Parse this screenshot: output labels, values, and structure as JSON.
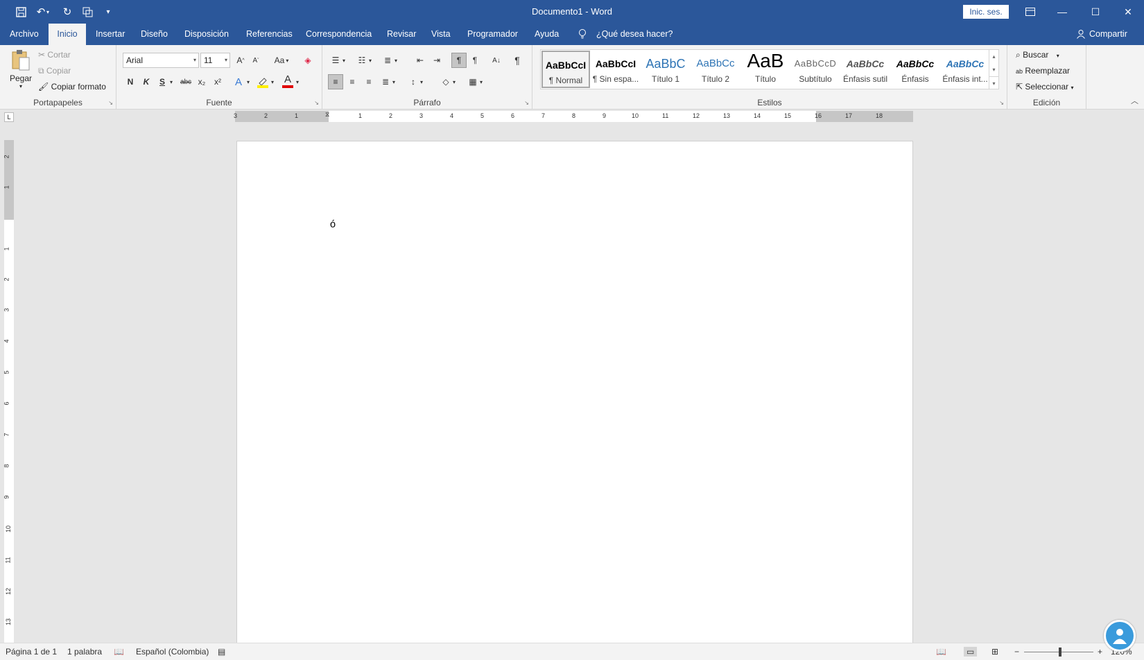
{
  "window": {
    "title": "Documento1 - Word",
    "signin": "Inic. ses.",
    "share": "Compartir"
  },
  "tabs": [
    "Archivo",
    "Inicio",
    "Insertar",
    "Diseño",
    "Disposición",
    "Referencias",
    "Correspondencia",
    "Revisar",
    "Vista",
    "Programador",
    "Ayuda"
  ],
  "tell_me": "¿Qué desea hacer?",
  "clipboard": {
    "label": "Portapapeles",
    "paste": "Pegar",
    "cut": "Cortar",
    "copy": "Copiar",
    "format_painter": "Copiar formato"
  },
  "font": {
    "label": "Fuente",
    "name": "Arial",
    "size": "11",
    "bold": "N",
    "italic": "K",
    "underline": "S",
    "strike": "abc",
    "subscript": "x₂",
    "superscript": "x²",
    "grow": "A^",
    "shrink": "Aˇ",
    "case": "Aa",
    "effects": "A",
    "highlight": "ab",
    "color": "A"
  },
  "paragraph": {
    "label": "Párrafo"
  },
  "styles": {
    "label": "Estilos",
    "items": [
      {
        "preview": "AaBbCcI",
        "name": "¶ Normal"
      },
      {
        "preview": "AaBbCcI",
        "name": "¶ Sin espa..."
      },
      {
        "preview": "AaBbC",
        "name": "Título 1"
      },
      {
        "preview": "AaBbCc",
        "name": "Título 2"
      },
      {
        "preview": "AaB",
        "name": "Título"
      },
      {
        "preview": "AaBbCcD",
        "name": "Subtítulo"
      },
      {
        "preview": "AaBbCc",
        "name": "Énfasis sutil"
      },
      {
        "preview": "AaBbCc",
        "name": "Énfasis"
      },
      {
        "preview": "AaBbCc",
        "name": "Énfasis int..."
      }
    ]
  },
  "editing": {
    "label": "Edición",
    "find": "Buscar",
    "replace": "Reemplazar",
    "select": "Seleccionar"
  },
  "ruler": {
    "h_left": [
      "3",
      "2",
      "1"
    ],
    "h_right": [
      "1",
      "2",
      "3",
      "4",
      "5",
      "6",
      "7",
      "8",
      "9",
      "10",
      "11",
      "12",
      "13",
      "14",
      "15",
      "16",
      "17",
      "18"
    ],
    "v_numbers": [
      "2",
      "1",
      "1",
      "2",
      "3",
      "4",
      "5",
      "6",
      "7",
      "8",
      "9",
      "10",
      "11",
      "12",
      "13"
    ]
  },
  "document": {
    "text": "ó"
  },
  "status": {
    "page": "Página 1 de 1",
    "words": "1 palabra",
    "language": "Español (Colombia)",
    "zoom": "120%",
    "zoom_level_fraction": 0.5
  }
}
